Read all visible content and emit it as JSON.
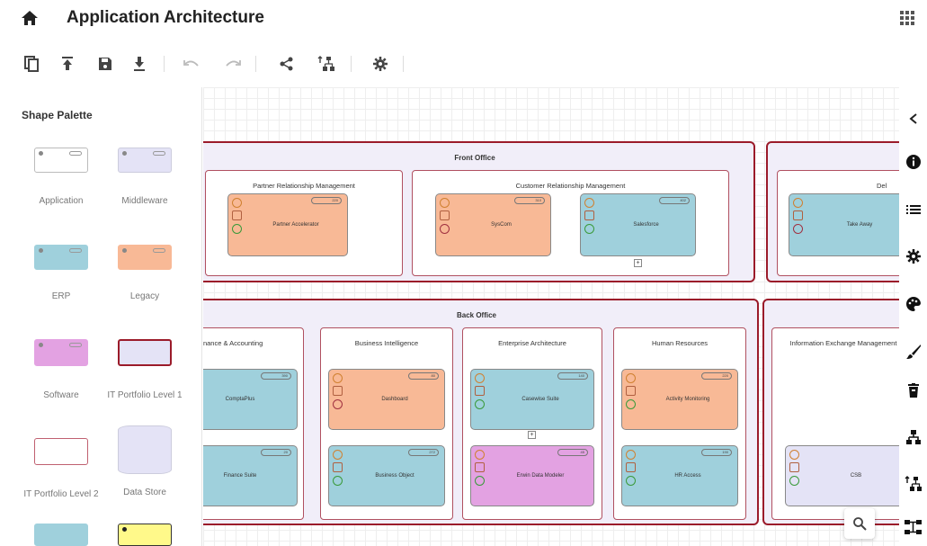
{
  "header": {
    "title": "Application Architecture"
  },
  "toolbar": {
    "buttons": [
      {
        "icon": "copy-icon"
      },
      {
        "icon": "upload-icon"
      },
      {
        "icon": "save-icon"
      },
      {
        "icon": "download-icon"
      },
      {
        "icon": "undo-icon"
      },
      {
        "icon": "redo-icon"
      },
      {
        "icon": "share-icon"
      },
      {
        "icon": "hierarchy-import-icon"
      },
      {
        "icon": "settings-icon"
      }
    ]
  },
  "palette": {
    "title": "Shape Palette",
    "items": [
      {
        "label": "Application",
        "color": "#ffffff"
      },
      {
        "label": "Middleware",
        "color": "#e4e3f6"
      },
      {
        "label": "ERP",
        "color": "#9fd0dc"
      },
      {
        "label": "Legacy",
        "color": "#f8b996"
      },
      {
        "label": "Software",
        "color": "#e3a2e2"
      },
      {
        "label": "IT Portfolio Level 1",
        "color": "#e4e3f6"
      },
      {
        "label": "IT Portfolio Level 2",
        "color": "#ffffff"
      },
      {
        "label": "Data Store",
        "color": "#e4e3f6"
      },
      {
        "label": "",
        "color": "#9fd0dc"
      },
      {
        "label": "",
        "color": "#fff98a"
      }
    ]
  },
  "diagram": {
    "front_office": {
      "title": "Front Office",
      "partner": {
        "title": "Partner Relationship Management",
        "apps": [
          {
            "name": "Partner Accelerator",
            "badge": "220"
          }
        ]
      },
      "crm": {
        "title": "Customer Relationship Management",
        "apps": [
          {
            "name": "SysCom",
            "badge": "310"
          },
          {
            "name": "Salesforce",
            "badge": "402"
          }
        ]
      }
    },
    "delivery": {
      "title": "Del",
      "apps": [
        {
          "name": "Take Away"
        }
      ]
    },
    "back_office": {
      "title": "Back Office",
      "finance": {
        "title": "Finance & Accounting",
        "apps": [
          {
            "name": "ComptaPlus",
            "badge": "390"
          },
          {
            "name": "Finance Suite",
            "badge": "20"
          }
        ]
      },
      "bi": {
        "title": "Business Intelligence",
        "apps": [
          {
            "name": "Dashboard",
            "badge": "80"
          },
          {
            "name": "Business Object",
            "badge": "272"
          }
        ]
      },
      "ea": {
        "title": "Enterprise Architecture",
        "apps": [
          {
            "name": "Casewise Suite",
            "badge": "140"
          },
          {
            "name": "Erwin Data Modeler",
            "badge": "45"
          }
        ]
      },
      "hr": {
        "title": "Human Resources",
        "apps": [
          {
            "name": "Activity Monitoring",
            "badge": "220"
          },
          {
            "name": "HR Access",
            "badge": "190"
          }
        ]
      }
    },
    "info": {
      "title": "Information Exchange Management",
      "apps": [
        {
          "name": "CSB"
        }
      ]
    }
  },
  "right_rail": {
    "items": [
      {
        "icon": "collapse-chevron-icon"
      },
      {
        "icon": "info-icon"
      },
      {
        "icon": "list-icon"
      },
      {
        "icon": "settings-icon"
      },
      {
        "icon": "palette-icon"
      },
      {
        "icon": "brush-icon"
      },
      {
        "icon": "trash-icon"
      },
      {
        "icon": "hierarchy-icon"
      },
      {
        "icon": "hierarchy-import-icon"
      },
      {
        "icon": "org-chart-icon"
      }
    ]
  },
  "colors": {
    "accent_border": "#9b1b2a",
    "group_bg": "#f1eef9",
    "legacy": "#f8b996",
    "erp": "#9fd0dc",
    "software": "#e3a2e2",
    "middleware": "#e4e3f6"
  }
}
